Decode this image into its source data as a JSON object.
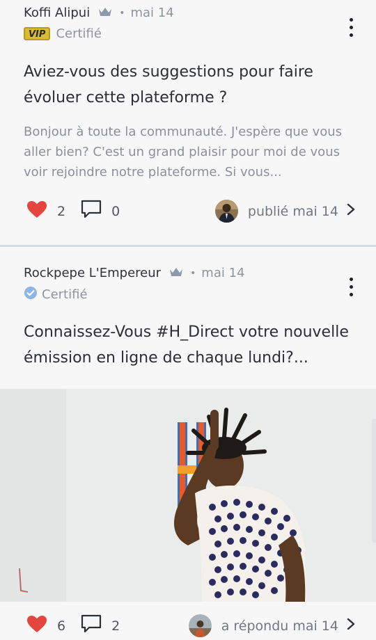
{
  "posts": [
    {
      "author": "Koffi Alipui",
      "date": "mai 14",
      "badge_label": "VIP",
      "certified": "Certifié",
      "title": "Aviez-vous des suggestions pour faire évoluer cette plateforme ?",
      "excerpt": "Bonjour à toute la communauté. J'espère que vous aller bien? C'est un grand plaisir pour moi de vous voir rejoindre notre plateforme. Si vous...",
      "likes": "2",
      "comments": "0",
      "footer_text": "publié mai 14"
    },
    {
      "author": "Rockpepe L'Empereur",
      "date": "mai 14",
      "certified": "Certifié",
      "title": "Connaissez-Vous #H_Direct votre nouvelle émission en ligne de chaque lundi?...",
      "likes": "6",
      "comments": "2",
      "footer_text": "a répondu mai 14"
    }
  ],
  "colors": {
    "heart": "#e5453f",
    "crown": "#8e99ad",
    "cert_check": "#8fb4e6",
    "separator": "#d3dbe3"
  },
  "icons": [
    "crown-icon",
    "heart-icon",
    "comment-icon",
    "kebab-menu-icon",
    "chevron-right-icon",
    "certified-check-icon"
  ]
}
